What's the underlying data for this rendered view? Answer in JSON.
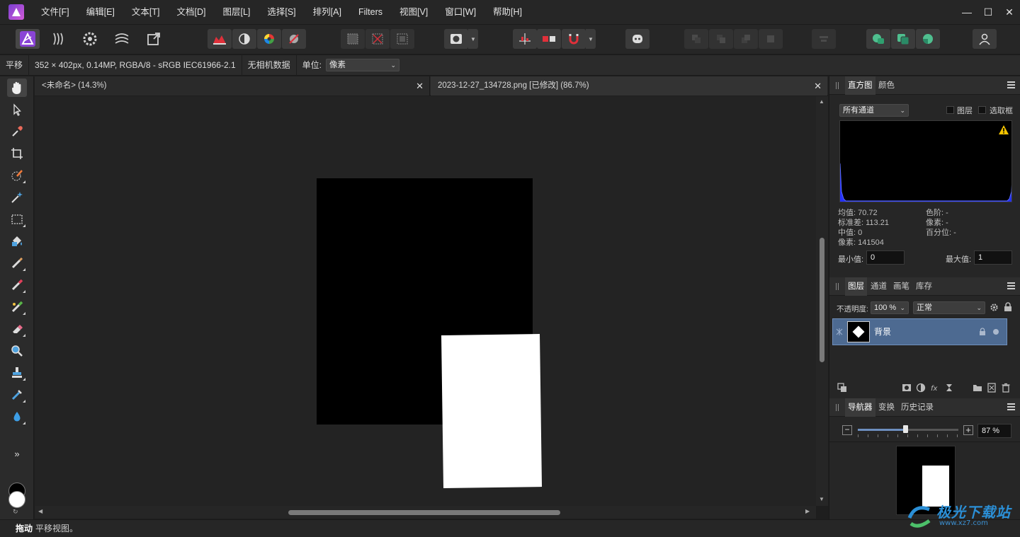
{
  "menu": {
    "items": [
      "文件[F]",
      "编辑[E]",
      "文本[T]",
      "文档[D]",
      "图层[L]",
      "选择[S]",
      "排列[A]",
      "Filters",
      "视图[V]",
      "窗口[W]",
      "帮助[H]"
    ]
  },
  "window_controls": {
    "minimize": "—",
    "maximize": "☐",
    "close": "✕"
  },
  "context": {
    "tool_name": "平移",
    "image_info": "352 × 402px, 0.14MP, RGBA/8 - sRGB IEC61966-2.1",
    "camera": "无相机数据",
    "unit_label": "单位:",
    "unit_value": "像素"
  },
  "tabs": [
    {
      "label": "<未命名> (14.3%)",
      "close": "✕"
    },
    {
      "label": "2023-12-27_134728.png [已修改] (86.7%)",
      "close": "✕"
    }
  ],
  "tools": {
    "more": "»"
  },
  "status": {
    "action": "拖动",
    "message": "平移视图。"
  },
  "histogram_panel": {
    "tabs": [
      "直方图",
      "颜色"
    ],
    "channel": "所有通道",
    "layer_label": "图层",
    "selection_label": "选取框",
    "stats_left": [
      "均值: 70.72",
      "标准差: 113.21",
      "中值: 0",
      "像素: 141504"
    ],
    "stats_right": [
      "色阶: -",
      "像素: -",
      "百分位: -"
    ],
    "min_label": "最小值:",
    "min_value": "0",
    "max_label": "最大值:",
    "max_value": "1"
  },
  "layers_panel": {
    "tabs": [
      "图层",
      "通道",
      "画笔",
      "库存"
    ],
    "opacity_label": "不透明度:",
    "opacity_value": "100 %",
    "blend_mode": "正常",
    "layer_name": "背景"
  },
  "navigator_panel": {
    "tabs": [
      "导航器",
      "变换",
      "历史记录"
    ],
    "zoom_value": "87 %",
    "zoom_level": 0.47,
    "minus": "−",
    "plus": "+"
  },
  "watermark": {
    "text": "极光下载站",
    "url": "www.xz7.com"
  },
  "colors": {
    "accent_layer": "#4d6a91",
    "histogram_blue": "#2430ff",
    "warning": "#f5c400",
    "app_logo": "#8a44d6"
  }
}
